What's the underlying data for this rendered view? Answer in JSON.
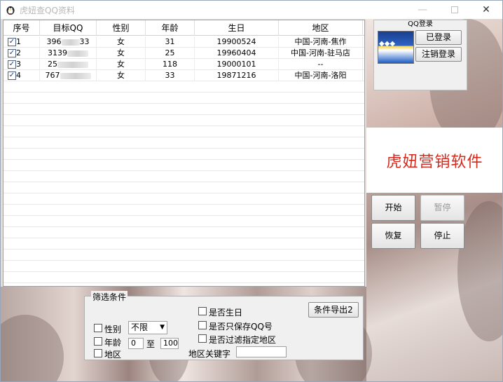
{
  "window": {
    "title": "虎妞查QQ资料"
  },
  "table": {
    "headers": [
      "序号",
      "目标QQ",
      "性别",
      "年龄",
      "生日",
      "地区"
    ],
    "rows": [
      {
        "idx": "1",
        "qq_prefix": "396",
        "qq_suffix": "33",
        "gender": "女",
        "age": "31",
        "birthday": "19900524",
        "region": "中国-河南-焦作"
      },
      {
        "idx": "2",
        "qq_prefix": "3139",
        "qq_suffix": "",
        "gender": "女",
        "age": "25",
        "birthday": "19960404",
        "region": "中国-河南-驻马店"
      },
      {
        "idx": "3",
        "qq_prefix": "25",
        "qq_suffix": "",
        "gender": "女",
        "age": "118",
        "birthday": "19000101",
        "region": "--"
      },
      {
        "idx": "4",
        "qq_prefix": "767",
        "qq_suffix": "",
        "gender": "女",
        "age": "33",
        "birthday": "19871216",
        "region": "中国-河南-洛阳"
      }
    ]
  },
  "qq_login": {
    "title": "QQ登录",
    "logged_in_label": "已登录",
    "logout_label": "注销登录"
  },
  "banner": {
    "text": "虎妞营销软件"
  },
  "controls": {
    "start": "开始",
    "pause": "暂停",
    "resume": "恢复",
    "stop": "停止"
  },
  "filter": {
    "legend": "筛选条件",
    "gender_label": "性别",
    "gender_value": "不限",
    "age_label": "年龄",
    "age_min": "0",
    "age_to": "至",
    "age_max": "100",
    "region_label": "地区",
    "birthday_label": "是否生日",
    "save_qq_only_label": "是否只保存QQ号",
    "filter_region_label": "是否过滤指定地区",
    "region_keyword_label": "地区关键字",
    "region_keyword_value": "",
    "export_label": "条件导出2"
  }
}
